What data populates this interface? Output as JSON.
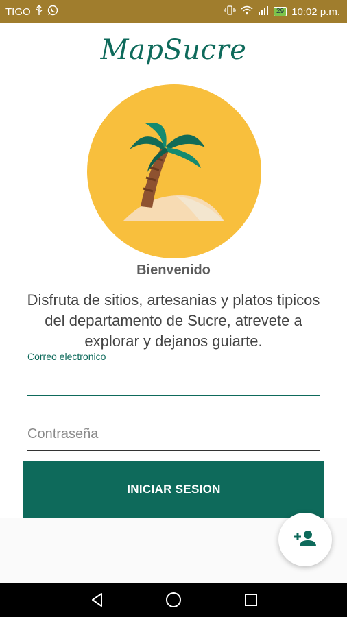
{
  "status_bar": {
    "carrier": "TIGO",
    "battery_level": "29",
    "time": "10:02 p.m.",
    "usb_icon": "usb-icon",
    "whatsapp_icon": "whatsapp-icon",
    "vibrate_icon": "vibrate-icon",
    "wifi_icon": "wifi-icon",
    "signal_icon": "signal-icon"
  },
  "app": {
    "title": "MapSucre",
    "logo_icon": "palm-island-icon"
  },
  "welcome": {
    "heading": "Bienvenido",
    "description": "Disfruta de sitios, artesanias y platos tipicos del departamento de Sucre, atrevete a explorar y dejanos guiarte."
  },
  "form": {
    "email_label": "Correo electronico",
    "email_value": "",
    "password_placeholder": "Contraseña",
    "login_label": "INICIAR SESION"
  },
  "fab": {
    "icon": "add-person-icon"
  },
  "navigation": {
    "back_icon": "back-icon",
    "home_icon": "home-icon",
    "recents_icon": "recents-icon"
  },
  "colors": {
    "primary": "#0e6a5b",
    "status_bar": "#a07d2d",
    "logo_circle": "#f8bf3d"
  }
}
